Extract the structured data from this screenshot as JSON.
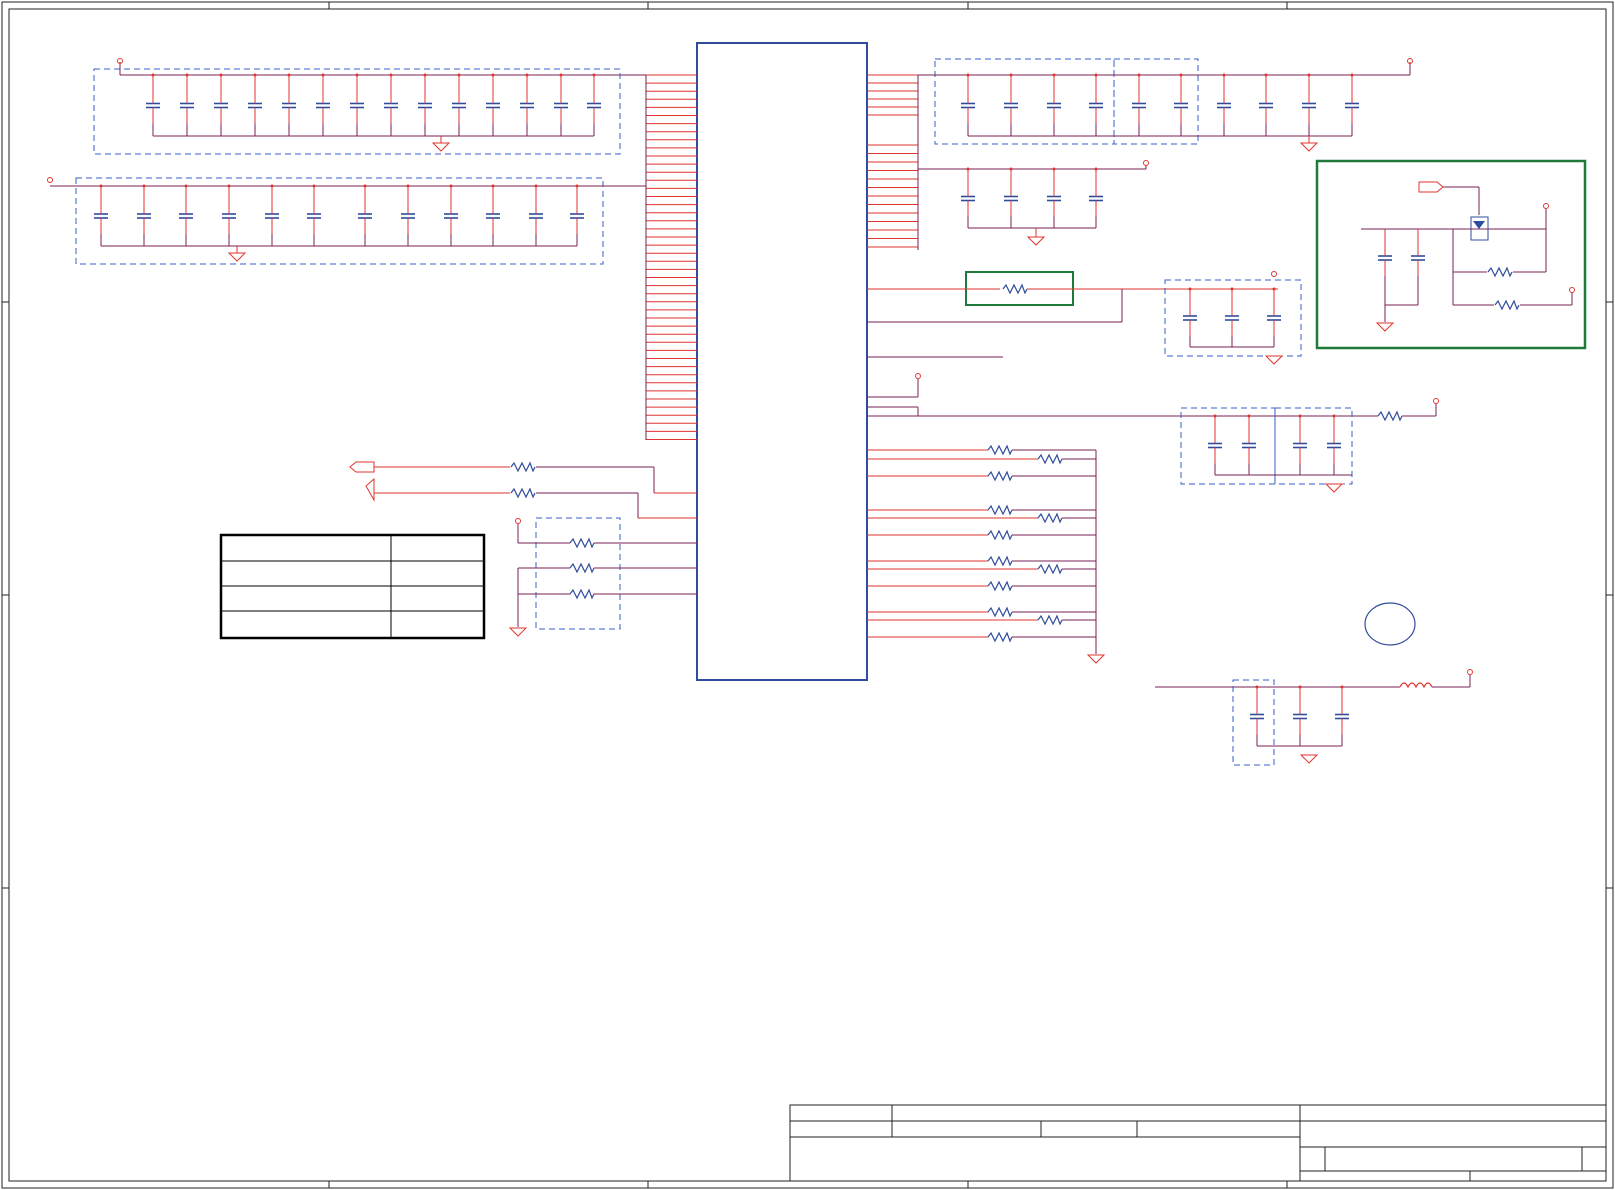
{
  "colors": {
    "wire": "#e0352f",
    "net": "#7a1f55",
    "part": "#2f4d9c",
    "group_box": "#3a5ccc",
    "highlight": "#1f7a3a",
    "frame": "#222222",
    "background": "#ffffff"
  },
  "legend_table": {
    "rows": [
      {
        "label": "",
        "value": ""
      },
      {
        "label": "",
        "value": ""
      },
      {
        "label": "",
        "value": ""
      },
      {
        "label": "",
        "value": ""
      }
    ]
  },
  "title_block": {
    "fields": [
      "",
      "",
      "",
      "",
      "",
      "",
      "",
      ""
    ]
  },
  "icons": [
    "ground-icon",
    "power-pin-icon",
    "capacitor-icon",
    "resistor-icon",
    "inductor-icon",
    "offpage-connector-icon",
    "diode-icon"
  ]
}
